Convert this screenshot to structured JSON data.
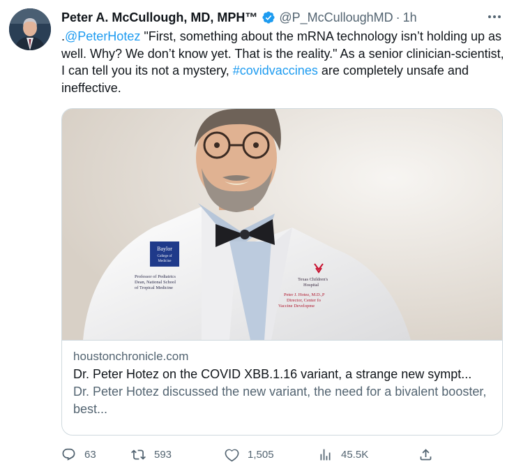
{
  "author": {
    "name": "Peter A. McCullough, MD, MPH™",
    "handle": "@P_McCulloughMD",
    "separator": "·",
    "time": "1h",
    "verified_color": "#1d9bf0",
    "avatar_icon": "profile-photo"
  },
  "tweet": {
    "prefix": ".",
    "mention": "@PeterHotez",
    "text_1": " \"First, something about the mRNA technology isn’t holding up as well. Why? We don’t know yet. That is the reality.\"  As a senior clinician-scientist, I can tell you its not a mystery, ",
    "hashtag": "#covidvaccines",
    "text_2": " are completely unsafe and ineffective.",
    "link_color": "#1d9bf0"
  },
  "card": {
    "domain": "houstonchronicle.com",
    "title": "Dr. Peter Hotez on the COVID XBB.1.16 variant, a strange new sympt...",
    "description": "Dr. Peter Hotez discussed the new variant, the need for a bivalent booster, best...",
    "image": {
      "badge_line1": "Baylor",
      "badge_line2": "College of",
      "badge_line3": "Medicine",
      "coat_left_1": "Professor of Pediatrics",
      "coat_left_2": "Dean, National School",
      "coat_left_3": "of Tropical Medicine",
      "coat_right_1": "Texas Children's",
      "coat_right_2": "Hospital",
      "coat_right_3": "Peter J. Hotez, M.D.,P",
      "coat_right_4": "Director, Center fo",
      "coat_right_5": "Vaccine Developme"
    }
  },
  "actions": {
    "replies": "63",
    "retweets": "593",
    "likes": "1,505",
    "views": "45.5K",
    "icons": [
      "reply-icon",
      "retweet-icon",
      "like-icon",
      "views-icon",
      "share-icon"
    ]
  }
}
